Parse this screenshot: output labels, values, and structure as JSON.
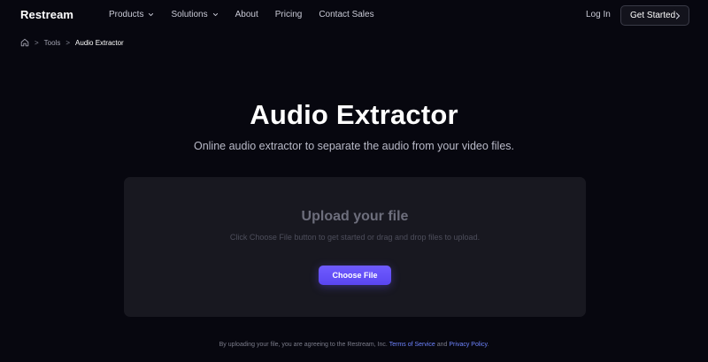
{
  "nav": {
    "logo": "Restream",
    "menu": [
      {
        "label": "Products",
        "has_dropdown": true
      },
      {
        "label": "Solutions",
        "has_dropdown": true
      },
      {
        "label": "About",
        "has_dropdown": false
      },
      {
        "label": "Pricing",
        "has_dropdown": false
      },
      {
        "label": "Contact Sales",
        "has_dropdown": false
      }
    ],
    "login": "Log In",
    "cta": "Get Started"
  },
  "breadcrumb": {
    "items": [
      "Tools",
      "Audio Extractor"
    ]
  },
  "hero": {
    "title": "Audio Extractor",
    "subtitle": "Online audio extractor to separate the audio from your video files."
  },
  "upload": {
    "title": "Upload your file",
    "description": "Click Choose File button to get started or drag and drop files to upload.",
    "button": "Choose File"
  },
  "legal": {
    "prefix": "By uploading your file, you are agreeing to the Restream, Inc. ",
    "terms": "Terms of Service",
    "and": " and ",
    "privacy": "Privacy Policy",
    "suffix": "."
  },
  "colors": {
    "background": "#07070f",
    "card": "#181820",
    "accent": "#6f5cff",
    "link": "#6e84ff"
  }
}
